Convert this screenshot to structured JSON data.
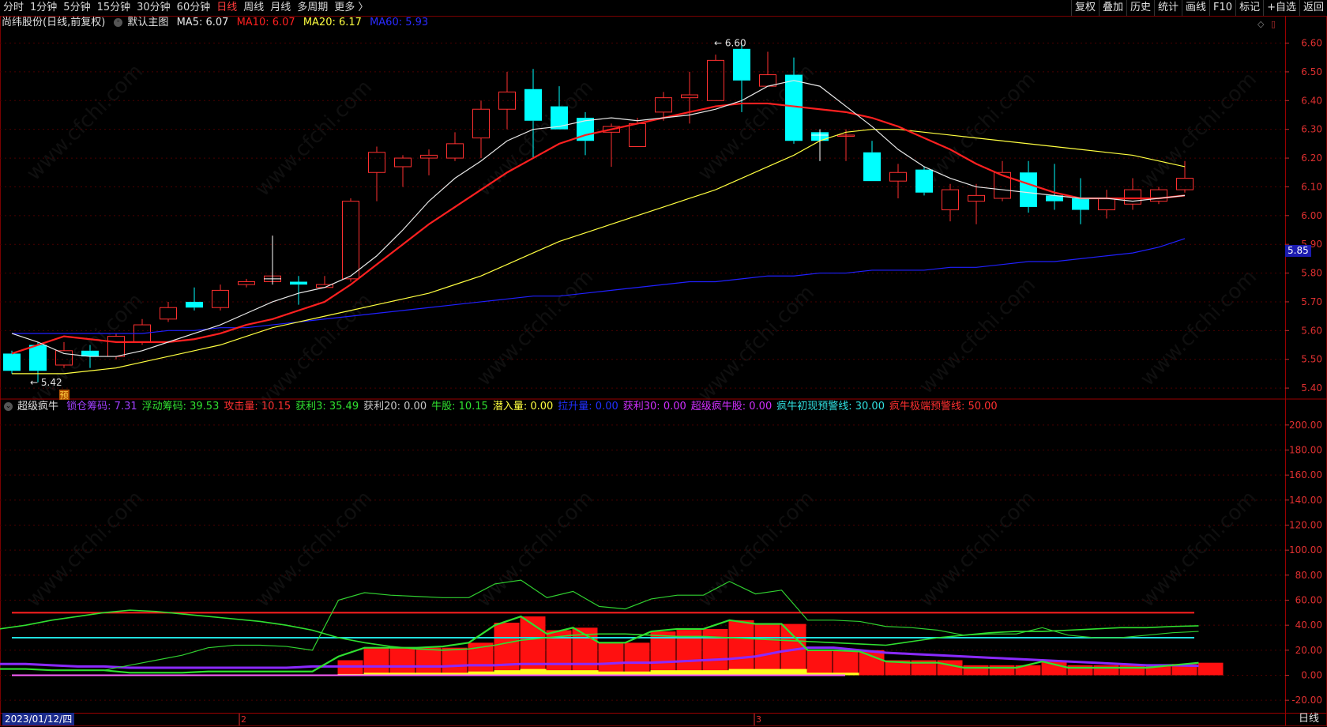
{
  "toolbar": {
    "periods": [
      "分时",
      "1分钟",
      "5分钟",
      "15分钟",
      "30分钟",
      "60分钟",
      "日线",
      "周线",
      "月线",
      "多周期",
      "更多 〉"
    ],
    "active_period": "日线",
    "right_items": [
      "复权",
      "叠加",
      "历史",
      "统计",
      "画线",
      "F10",
      "标记",
      "+自选",
      "返回"
    ]
  },
  "main_info": {
    "title": "尚纬股份(日线,前复权)",
    "template": "默认主图",
    "ma5": "MA5: 6.07",
    "ma10": "MA10: 6.07",
    "ma20": "MA20: 6.17",
    "ma60": "MA60: 5.93"
  },
  "indicator_info": {
    "name": "超级疯牛",
    "items": [
      {
        "text": "锁仓筹码: 7.31",
        "color": "#a040ff"
      },
      {
        "text": "浮动筹码: 39.53",
        "color": "#30e030"
      },
      {
        "text": "攻击量: 10.15",
        "color": "#ff3030"
      },
      {
        "text": "获利3: 35.49",
        "color": "#30e030"
      },
      {
        "text": "获利20: 0.00",
        "color": "#c8c8c8"
      },
      {
        "text": "牛股: 10.15",
        "color": "#30e030"
      },
      {
        "text": "潜入量: 0.00",
        "color": "#ffff40"
      },
      {
        "text": "拉升量: 0.00",
        "color": "#2030ff"
      },
      {
        "text": "获利30: 0.00",
        "color": "#d030ff"
      },
      {
        "text": "超级疯牛股: 0.00",
        "color": "#d030ff"
      },
      {
        "text": "疯牛初现预警线: 30.00",
        "color": "#30e0e0"
      },
      {
        "text": "疯牛极端预警线: 50.00",
        "color": "#ff3030"
      }
    ]
  },
  "colors": {
    "up": "#ff3030",
    "down": "#00ffff",
    "ma5": "#e8e8e8",
    "ma10": "#ff2020",
    "ma20": "#ffff40",
    "ma60": "#2020ff",
    "grid": "#4a0000"
  },
  "price_axis": {
    "ticks": [
      "6.60",
      "6.50",
      "6.40",
      "6.30",
      "6.20",
      "6.10",
      "6.00",
      "5.90",
      "5.80",
      "5.70",
      "5.60",
      "5.50",
      "5.40"
    ],
    "current_tag": "5.85"
  },
  "ind_axis": {
    "ticks": [
      "200.00",
      "180.00",
      "160.00",
      "140.00",
      "120.00",
      "100.00",
      "80.00",
      "60.00",
      "40.00",
      "20.00",
      "0.00",
      "-20.00"
    ]
  },
  "annotations": {
    "high": "6.60",
    "low": "5.42",
    "pre_mark": "预"
  },
  "month_marks": [
    "2",
    "3"
  ],
  "bottom": {
    "date": "2023/01/12/四",
    "tab": "日线"
  },
  "watermark": "www.cfchi.com",
  "chart_data": {
    "type": "candlestick",
    "candles": [
      [
        5.52,
        5.46,
        5.53,
        5.45
      ],
      [
        5.55,
        5.46,
        5.56,
        5.42
      ],
      [
        5.48,
        5.53,
        5.56,
        5.47
      ],
      [
        5.53,
        5.51,
        5.55,
        5.47
      ],
      [
        5.51,
        5.58,
        5.59,
        5.5
      ],
      [
        5.56,
        5.62,
        5.64,
        5.55
      ],
      [
        5.64,
        5.68,
        5.7,
        5.63
      ],
      [
        5.7,
        5.68,
        5.75,
        5.67
      ],
      [
        5.68,
        5.74,
        5.76,
        5.67
      ],
      [
        5.76,
        5.77,
        5.78,
        5.75
      ],
      [
        5.77,
        5.79,
        5.93,
        5.76
      ],
      [
        5.77,
        5.76,
        5.79,
        5.69
      ],
      [
        5.75,
        5.76,
        5.79,
        5.75
      ],
      [
        5.78,
        6.05,
        6.06,
        5.77
      ],
      [
        6.15,
        6.22,
        6.24,
        6.05
      ],
      [
        6.17,
        6.2,
        6.21,
        6.1
      ],
      [
        6.2,
        6.21,
        6.23,
        6.14
      ],
      [
        6.2,
        6.25,
        6.29,
        6.19
      ],
      [
        6.27,
        6.37,
        6.4,
        6.2
      ],
      [
        6.37,
        6.43,
        6.5,
        6.3
      ],
      [
        6.44,
        6.33,
        6.51,
        6.2
      ],
      [
        6.38,
        6.3,
        6.45,
        6.3
      ],
      [
        6.34,
        6.26,
        6.36,
        6.21
      ],
      [
        6.29,
        6.31,
        6.32,
        6.17
      ],
      [
        6.24,
        6.32,
        6.34,
        6.24
      ],
      [
        6.36,
        6.41,
        6.43,
        6.33
      ],
      [
        6.41,
        6.42,
        6.5,
        6.32
      ],
      [
        6.4,
        6.54,
        6.56,
        6.4
      ],
      [
        6.58,
        6.47,
        6.6,
        6.36
      ],
      [
        6.45,
        6.49,
        6.57,
        6.45
      ],
      [
        6.49,
        6.26,
        6.55,
        6.25
      ],
      [
        6.29,
        6.26,
        6.3,
        6.19
      ],
      [
        6.28,
        6.28,
        6.3,
        6.19
      ],
      [
        6.22,
        6.12,
        6.26,
        6.12
      ],
      [
        6.12,
        6.15,
        6.18,
        6.06
      ],
      [
        6.16,
        6.08,
        6.17,
        6.07
      ],
      [
        6.02,
        6.09,
        6.11,
        5.98
      ],
      [
        6.05,
        6.07,
        6.11,
        5.97
      ],
      [
        6.06,
        6.15,
        6.19,
        6.05
      ],
      [
        6.15,
        6.03,
        6.19,
        6.01
      ],
      [
        6.07,
        6.05,
        6.18,
        6.02
      ],
      [
        6.06,
        6.02,
        6.13,
        5.97
      ],
      [
        6.02,
        6.06,
        6.09,
        5.99
      ],
      [
        6.04,
        6.09,
        6.13,
        6.02
      ],
      [
        6.05,
        6.09,
        6.1,
        6.04
      ],
      [
        6.09,
        6.13,
        6.19,
        6.08
      ]
    ],
    "ylim": [
      5.37,
      6.64
    ],
    "ma5": [
      5.59,
      5.56,
      5.52,
      5.51,
      5.51,
      5.53,
      5.56,
      5.59,
      5.62,
      5.66,
      5.7,
      5.73,
      5.75,
      5.79,
      5.86,
      5.95,
      6.05,
      6.13,
      6.19,
      6.26,
      6.3,
      6.31,
      6.33,
      6.34,
      6.33,
      6.34,
      6.35,
      6.37,
      6.4,
      6.45,
      6.47,
      6.45,
      6.38,
      6.31,
      6.23,
      6.17,
      6.13,
      6.1,
      6.09,
      6.08,
      6.07,
      6.06,
      6.06,
      6.05,
      6.06,
      6.07
    ],
    "ma10": [
      5.52,
      5.55,
      5.58,
      5.57,
      5.56,
      5.56,
      5.56,
      5.57,
      5.59,
      5.62,
      5.64,
      5.67,
      5.7,
      5.76,
      5.83,
      5.9,
      5.97,
      6.03,
      6.09,
      6.15,
      6.2,
      6.25,
      6.28,
      6.3,
      6.32,
      6.34,
      6.36,
      6.38,
      6.39,
      6.39,
      6.38,
      6.37,
      6.36,
      6.34,
      6.31,
      6.27,
      6.23,
      6.18,
      6.14,
      6.11,
      6.08,
      6.06,
      6.06,
      6.06,
      6.06,
      6.07
    ],
    "ma20": [
      5.45,
      5.45,
      5.45,
      5.46,
      5.47,
      5.49,
      5.51,
      5.53,
      5.55,
      5.58,
      5.61,
      5.63,
      5.65,
      5.67,
      5.69,
      5.71,
      5.73,
      5.76,
      5.79,
      5.83,
      5.87,
      5.91,
      5.94,
      5.97,
      6.0,
      6.03,
      6.06,
      6.09,
      6.13,
      6.17,
      6.21,
      6.26,
      6.29,
      6.3,
      6.3,
      6.29,
      6.28,
      6.27,
      6.26,
      6.25,
      6.24,
      6.23,
      6.22,
      6.21,
      6.19,
      6.17
    ],
    "ma60": [
      5.59,
      5.59,
      5.59,
      5.59,
      5.59,
      5.59,
      5.6,
      5.6,
      5.61,
      5.61,
      5.62,
      5.63,
      5.64,
      5.65,
      5.66,
      5.67,
      5.68,
      5.69,
      5.7,
      5.71,
      5.72,
      5.72,
      5.73,
      5.74,
      5.75,
      5.76,
      5.77,
      5.77,
      5.78,
      5.79,
      5.79,
      5.8,
      5.8,
      5.81,
      5.81,
      5.81,
      5.82,
      5.82,
      5.83,
      5.84,
      5.84,
      5.85,
      5.86,
      5.87,
      5.89,
      5.92
    ],
    "ind_ylim": [
      -30,
      210
    ],
    "attack_bars": [
      0,
      0,
      0,
      0,
      0,
      0,
      0,
      0,
      0,
      0,
      0,
      0,
      0,
      12,
      22,
      22,
      22,
      22,
      26,
      42,
      47,
      36,
      38,
      26,
      26,
      35,
      37,
      37,
      44,
      41,
      41,
      20,
      20,
      20,
      12,
      12,
      12,
      8,
      8,
      8,
      12,
      8,
      8,
      8,
      8,
      9,
      10
    ],
    "yellow_bars": [
      0,
      0,
      0,
      0,
      0,
      0,
      0,
      0,
      0,
      0,
      0,
      0,
      0,
      1,
      2,
      2,
      2,
      2,
      3,
      4,
      5,
      4,
      4,
      3,
      3,
      4,
      4,
      4,
      5,
      5,
      5,
      2,
      2,
      0,
      0,
      0,
      0,
      0,
      0,
      0,
      0,
      0,
      0,
      0,
      0,
      0,
      0
    ],
    "float_line": [
      37,
      40,
      44,
      47,
      50,
      52,
      51,
      49,
      47,
      45,
      43,
      40,
      36,
      30,
      26,
      23,
      21,
      20,
      21,
      24,
      28,
      30,
      32,
      33,
      33,
      32,
      31,
      31,
      30,
      29,
      28,
      27,
      26,
      25,
      24,
      27,
      30,
      32,
      34,
      35,
      35,
      36,
      37,
      38,
      38,
      39,
      39.5
    ],
    "profit3_line": [
      5,
      5,
      4,
      4,
      4,
      8,
      12,
      16,
      22,
      24,
      24,
      23,
      20,
      60,
      66,
      64,
      63,
      62,
      62,
      73,
      76,
      62,
      67,
      55,
      53,
      61,
      64,
      64,
      75,
      65,
      68,
      44,
      44,
      43,
      39,
      38,
      36,
      32,
      33,
      33,
      38,
      32,
      30,
      30,
      32,
      34,
      35
    ],
    "green_bold": [
      5,
      5,
      4,
      4,
      4,
      2,
      2,
      2,
      3,
      3,
      3,
      3,
      3,
      15,
      22,
      22,
      22,
      23,
      26,
      40,
      47,
      33,
      38,
      26,
      26,
      35,
      37,
      37,
      44,
      41,
      41,
      20,
      20,
      19,
      11,
      10,
      10,
      6,
      6,
      6,
      11,
      6,
      6,
      6,
      6,
      8,
      10
    ],
    "lock_line": [
      9,
      9,
      8,
      7,
      7,
      6,
      6,
      6,
      6,
      6,
      6,
      6,
      7,
      7,
      7,
      7,
      7,
      7,
      8,
      8,
      9,
      9,
      9,
      9,
      10,
      10,
      11,
      12,
      13,
      15,
      19,
      22,
      22,
      20,
      18,
      17,
      16,
      15,
      14,
      13,
      12,
      11,
      10,
      9,
      8,
      8,
      7.5
    ],
    "warn_lines": {
      "initial": 30,
      "extreme": 50
    }
  }
}
